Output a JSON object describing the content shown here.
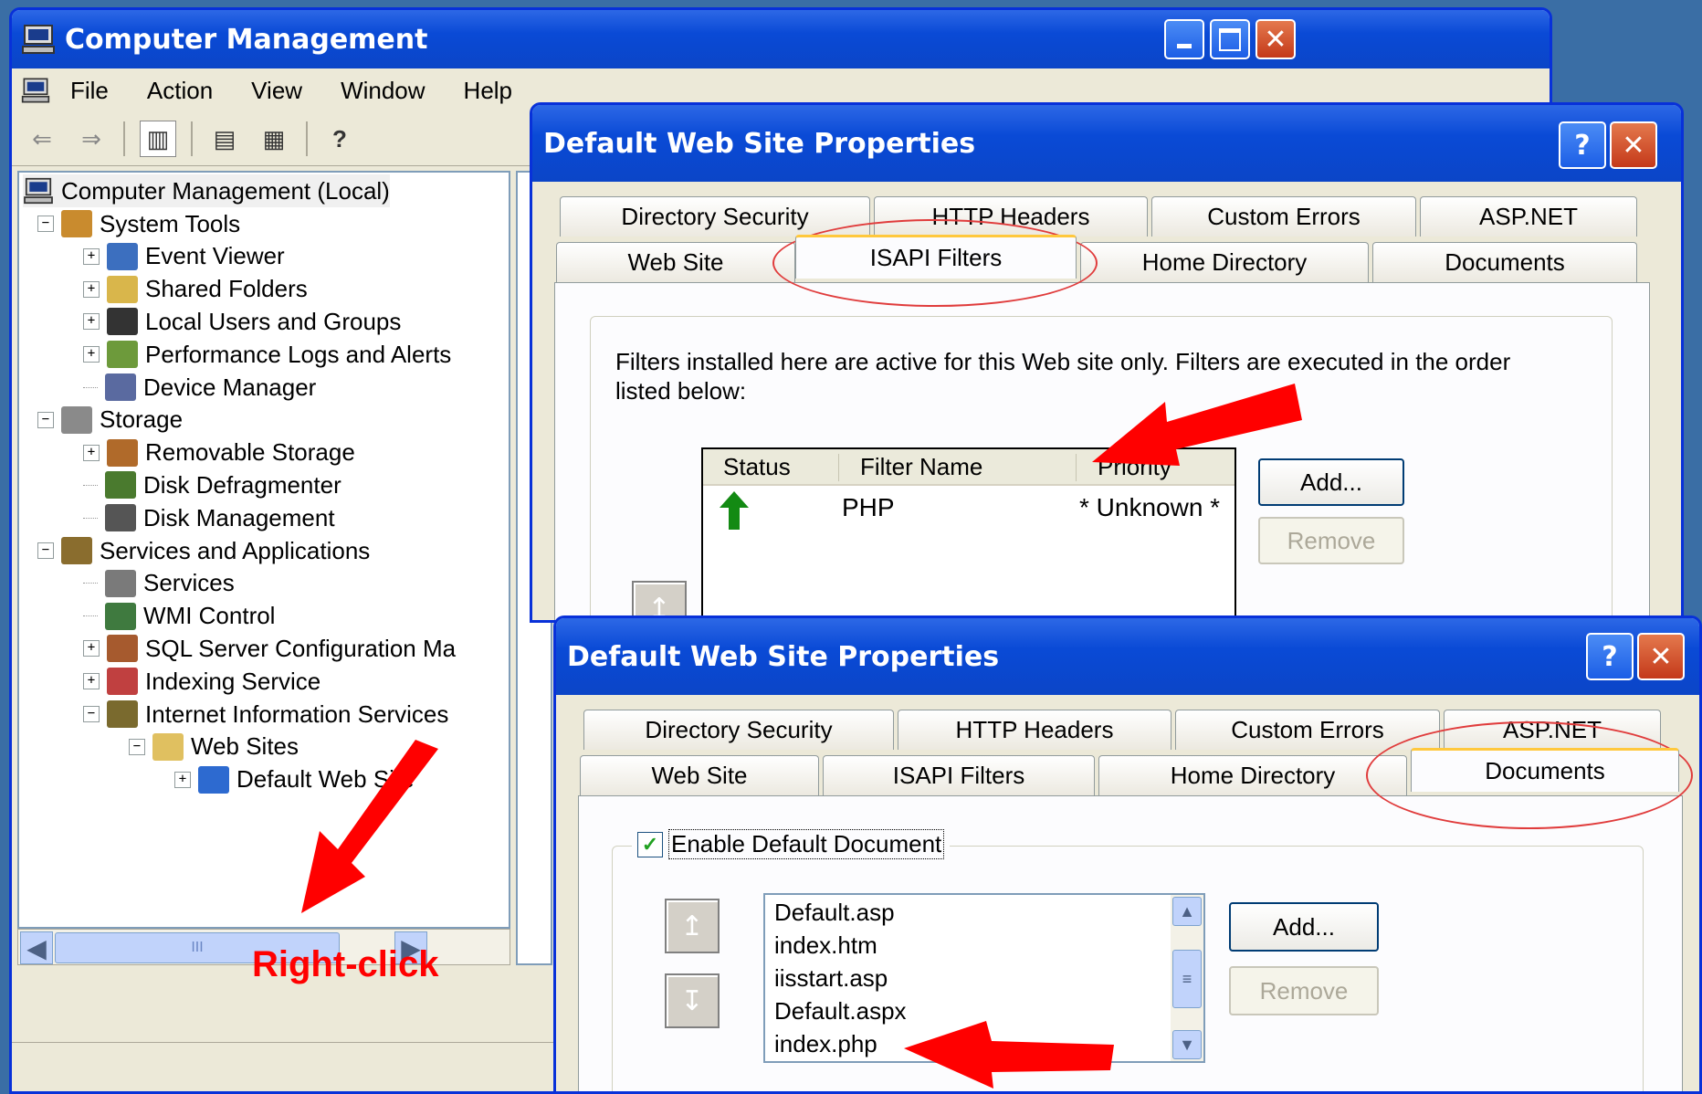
{
  "main_window": {
    "title": "Computer Management",
    "menu": [
      "File",
      "Action",
      "View",
      "Window",
      "Help"
    ],
    "tree": {
      "root": "Computer Management (Local)",
      "items": [
        {
          "label": "System Tools",
          "level": 1,
          "expander": "−"
        },
        {
          "label": "Event Viewer",
          "level": 2,
          "expander": "+"
        },
        {
          "label": "Shared Folders",
          "level": 2,
          "expander": "+"
        },
        {
          "label": "Local Users and Groups",
          "level": 2,
          "expander": "+"
        },
        {
          "label": "Performance Logs and Alerts",
          "level": 2,
          "expander": "+"
        },
        {
          "label": "Device Manager",
          "level": 2,
          "expander": ""
        },
        {
          "label": "Storage",
          "level": 1,
          "expander": "−"
        },
        {
          "label": "Removable Storage",
          "level": 2,
          "expander": "+"
        },
        {
          "label": "Disk Defragmenter",
          "level": 2,
          "expander": ""
        },
        {
          "label": "Disk Management",
          "level": 2,
          "expander": ""
        },
        {
          "label": "Services and Applications",
          "level": 1,
          "expander": "−"
        },
        {
          "label": "Services",
          "level": 2,
          "expander": ""
        },
        {
          "label": "WMI Control",
          "level": 2,
          "expander": ""
        },
        {
          "label": "SQL Server Configuration Ma",
          "level": 2,
          "expander": "+"
        },
        {
          "label": "Indexing Service",
          "level": 2,
          "expander": "+"
        },
        {
          "label": "Internet Information Services",
          "level": 2,
          "expander": "−"
        },
        {
          "label": "Web Sites",
          "level": 3,
          "expander": "−"
        },
        {
          "label": "Default Web Site",
          "level": 4,
          "expander": "+"
        }
      ]
    },
    "scroll_thumb": "III"
  },
  "annotation": {
    "right_click": "Right-click"
  },
  "dialog_top": {
    "title": "Default Web Site Properties",
    "help_btn": "?",
    "close_btn": "✕",
    "tabs_row1": [
      "Directory Security",
      "HTTP Headers",
      "Custom Errors",
      "ASP.NET"
    ],
    "tabs_row2": [
      "Web Site",
      "ISAPI Filters",
      "Home Directory",
      "Documents"
    ],
    "active_tab": "ISAPI Filters",
    "description": "Filters installed here are active for this Web site only. Filters are executed in the order listed below:",
    "columns": [
      "Status",
      "Filter Name",
      "Priority"
    ],
    "rows": [
      {
        "status": "up-arrow",
        "name": "PHP",
        "priority": "* Unknown *"
      }
    ],
    "add_btn": "Add...",
    "remove_btn": "Remove"
  },
  "dialog_bottom": {
    "title": "Default Web Site Properties",
    "help_btn": "?",
    "close_btn": "✕",
    "tabs_row1": [
      "Directory Security",
      "HTTP Headers",
      "Custom Errors",
      "ASP.NET"
    ],
    "tabs_row2": [
      "Web Site",
      "ISAPI Filters",
      "Home Directory",
      "Documents"
    ],
    "active_tab": "Documents",
    "enable_default": {
      "label": "Enable Default Document",
      "checked": true
    },
    "documents": [
      "Default.asp",
      "index.htm",
      "iisstart.asp",
      "Default.aspx",
      "index.php"
    ],
    "add_btn": "Add...",
    "remove_btn": "Remove"
  },
  "colors": {
    "accent": "#0831d9",
    "annotation": "#ff0000",
    "filter_status": "#138a13"
  }
}
